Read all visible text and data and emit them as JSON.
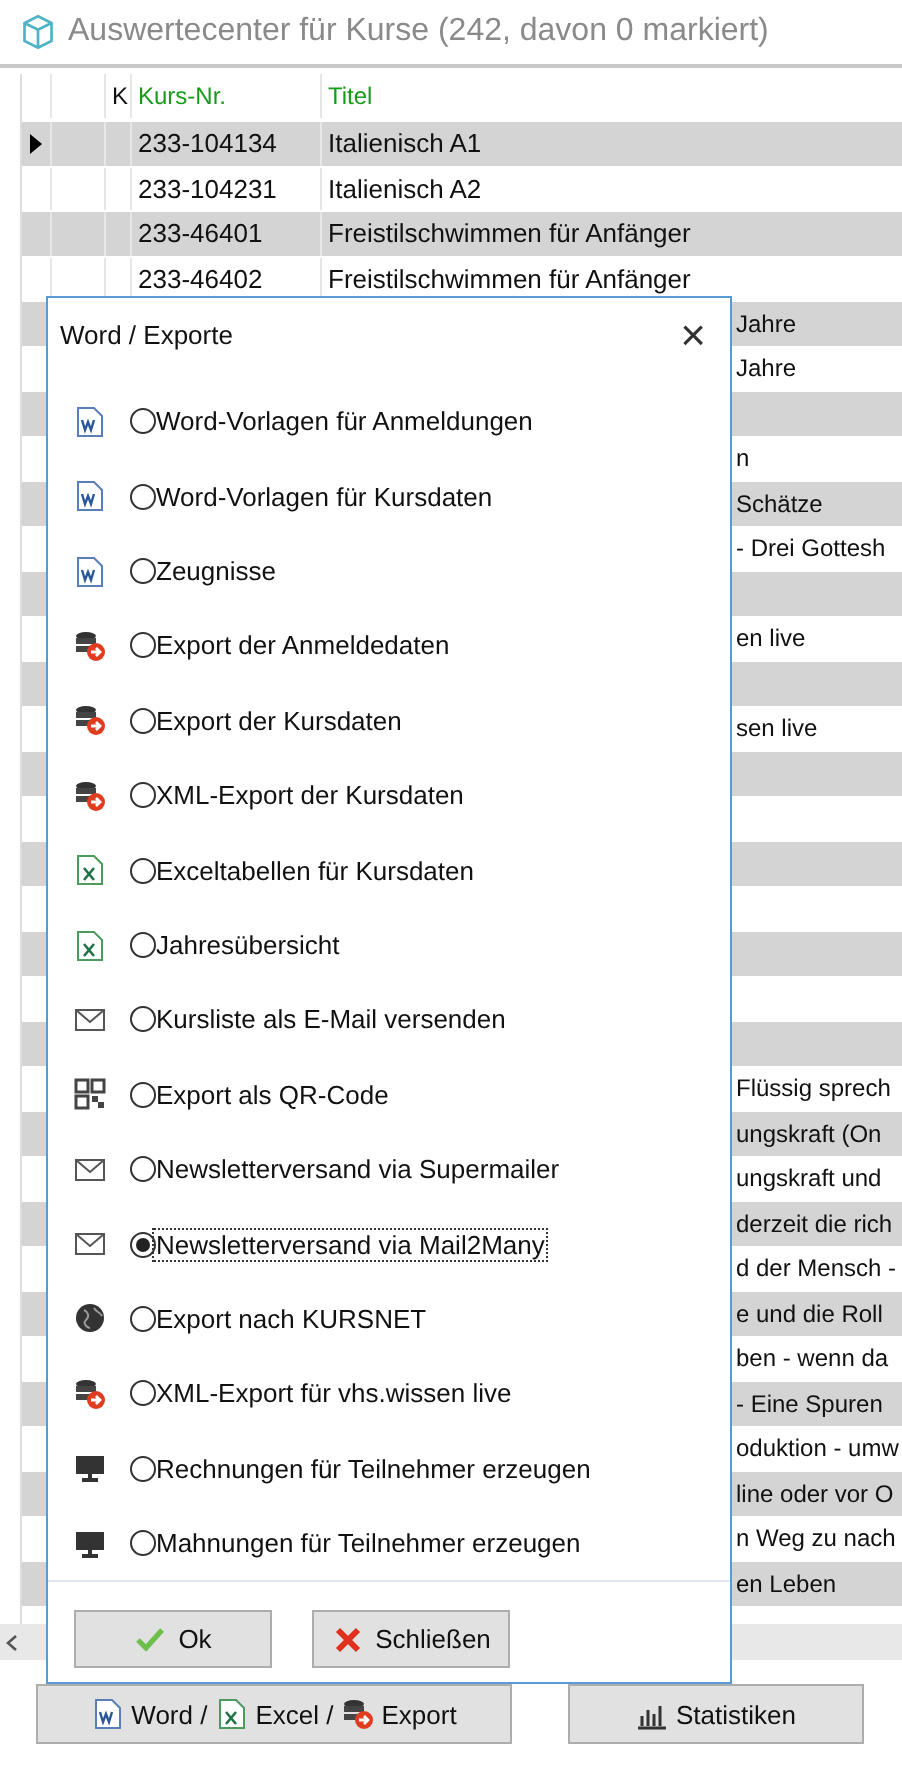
{
  "window": {
    "title": "Auswertecenter für Kurse (242, davon 0 markiert)"
  },
  "table": {
    "columns": [
      {
        "label": "K"
      },
      {
        "label": "Kurs-Nr."
      },
      {
        "label": "Titel"
      }
    ],
    "rows": [
      {
        "kind": "full",
        "kurs_nr": "233-104134",
        "titel": "Italienisch A1",
        "selected": true
      },
      {
        "kind": "full",
        "kurs_nr": "233-104231",
        "titel": "Italienisch A2",
        "selected": false
      },
      {
        "kind": "full",
        "kurs_nr": "233-46401",
        "titel": "Freistilschwimmen für Anfänger",
        "selected": false
      },
      {
        "kind": "full",
        "kurs_nr": "233-46402",
        "titel": "Freistilschwimmen für Anfänger",
        "selected": false
      },
      {
        "kind": "covered",
        "titel": "Jahre"
      },
      {
        "kind": "covered",
        "titel": "Jahre"
      },
      {
        "kind": "covered"
      },
      {
        "kind": "covered",
        "titel": "n"
      },
      {
        "kind": "covered",
        "titel": "Schätze"
      },
      {
        "kind": "covered",
        "titel": "- Drei Gottesh"
      },
      {
        "kind": "covered"
      },
      {
        "kind": "covered",
        "titel": "en live"
      },
      {
        "kind": "covered"
      },
      {
        "kind": "covered",
        "titel": "sen live"
      },
      {
        "kind": "covered"
      },
      {
        "kind": "covered"
      },
      {
        "kind": "covered"
      },
      {
        "kind": "covered"
      },
      {
        "kind": "covered"
      },
      {
        "kind": "covered"
      },
      {
        "kind": "covered"
      },
      {
        "kind": "covered",
        "titel": "Flüssig sprech"
      },
      {
        "kind": "covered",
        "titel": "ungskraft  (On"
      },
      {
        "kind": "covered",
        "titel": "ungskraft und"
      },
      {
        "kind": "covered",
        "titel": "derzeit die rich"
      },
      {
        "kind": "covered",
        "titel": "d der Mensch -"
      },
      {
        "kind": "covered",
        "titel": "e und die Roll"
      },
      {
        "kind": "covered",
        "titel": "ben - wenn da"
      },
      {
        "kind": "covered",
        "titel": "- Eine Spuren"
      },
      {
        "kind": "covered",
        "titel": "oduktion - umw"
      },
      {
        "kind": "covered",
        "titel": "line oder vor O"
      },
      {
        "kind": "covered",
        "titel": "n Weg zu nach"
      },
      {
        "kind": "covered",
        "titel": "en Leben"
      }
    ]
  },
  "dialog": {
    "title": "Word / Exporte",
    "close": "×",
    "options": [
      {
        "kind": "word",
        "label": "Word-Vorlagen für Anmeldungen",
        "selected": false
      },
      {
        "kind": "word",
        "label": "Word-Vorlagen für Kursdaten",
        "selected": false
      },
      {
        "kind": "word",
        "label": "Zeugnisse",
        "selected": false
      },
      {
        "kind": "export",
        "label": "Export der Anmeldedaten",
        "selected": false
      },
      {
        "kind": "export",
        "label": "Export der Kursdaten",
        "selected": false
      },
      {
        "kind": "export",
        "label": "XML-Export der Kursdaten",
        "selected": false
      },
      {
        "kind": "excel",
        "label": "Exceltabellen für Kursdaten",
        "selected": false
      },
      {
        "kind": "excel",
        "label": "Jahresübersicht",
        "selected": false
      },
      {
        "kind": "mail",
        "label": "Kursliste als E-Mail versenden",
        "selected": false
      },
      {
        "kind": "qr",
        "label": "Export als QR-Code",
        "selected": false
      },
      {
        "kind": "mail",
        "label": "Newsletterversand via Supermailer",
        "selected": false
      },
      {
        "kind": "mail",
        "label": "Newsletterversand via Mail2Many",
        "selected": true
      },
      {
        "kind": "globe",
        "label": "Export nach KURSNET",
        "selected": false
      },
      {
        "kind": "export",
        "label": "XML-Export für vhs.wissen live",
        "selected": false
      },
      {
        "kind": "monitor",
        "label": "Rechnungen für Teilnehmer erzeugen",
        "selected": false
      },
      {
        "kind": "monitor",
        "label": "Mahnungen für Teilnehmer erzeugen",
        "selected": false
      }
    ],
    "buttons": [
      {
        "kind": "ok",
        "label": "Ok"
      },
      {
        "kind": "close",
        "label": "Schließen"
      }
    ]
  },
  "footer": {
    "export_button": [
      "Word /",
      "Excel /",
      "Export"
    ],
    "stats_button": "Statistiken"
  }
}
